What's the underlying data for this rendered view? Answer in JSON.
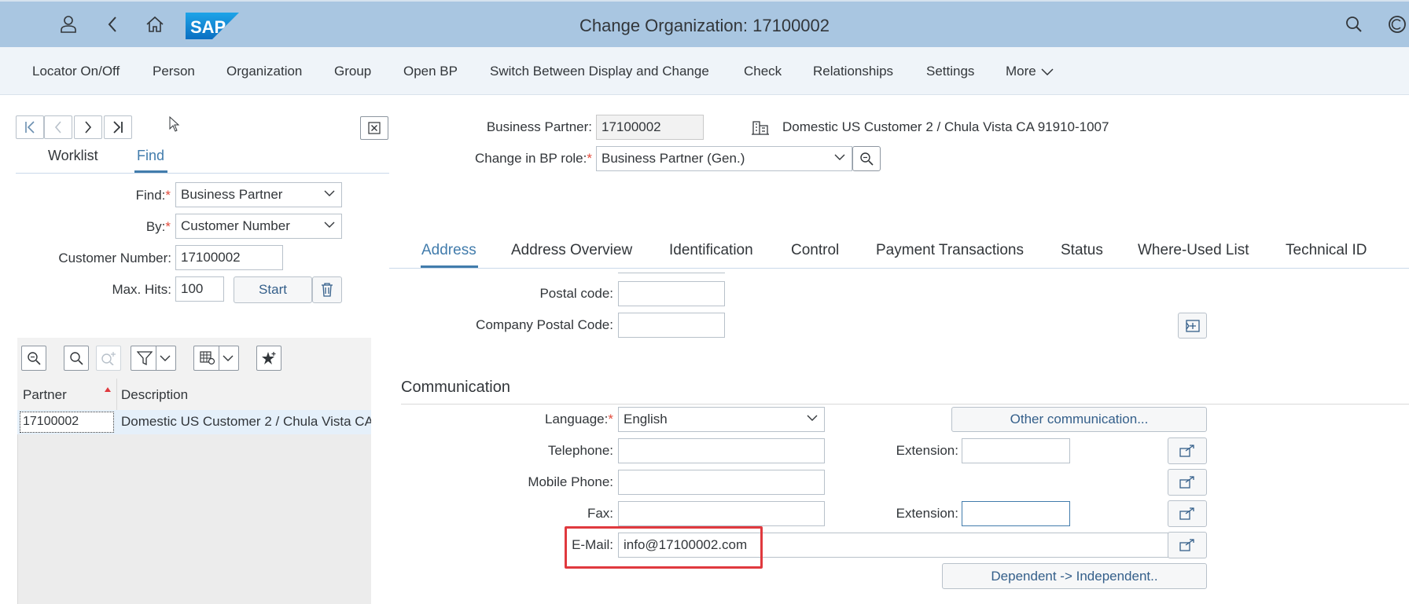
{
  "shell": {
    "title": "Change Organization: 17100002",
    "logo_text": "SAP"
  },
  "toolbar": {
    "items": [
      "Locator On/Off",
      "Person",
      "Organization",
      "Group",
      "Open BP",
      "Switch Between Display and Change",
      "Check",
      "Relationships",
      "Settings",
      "More"
    ]
  },
  "left_panel": {
    "tabs": [
      "Worklist",
      "Find"
    ],
    "active_tab": "Find",
    "find_label": "Find:",
    "find_value": "Business Partner",
    "by_label": "By:",
    "by_value": "Customer Number",
    "customer_number_label": "Customer Number:",
    "customer_number_value": "17100002",
    "max_hits_label": "Max. Hits:",
    "max_hits_value": "100",
    "start_label": "Start",
    "grid": {
      "columns": [
        "Partner",
        "Description"
      ],
      "rows": [
        {
          "partner": "17100002",
          "description": "Domestic US Customer 2 / Chula Vista CA"
        }
      ]
    }
  },
  "header": {
    "bp_label": "Business Partner:",
    "bp_value": "17100002",
    "bp_description": "Domestic US Customer 2 / Chula Vista CA 91910-1007",
    "role_label": "Change in BP role:",
    "role_value": "Business Partner (Gen.)"
  },
  "tabs": [
    "Address",
    "Address Overview",
    "Identification",
    "Control",
    "Payment Transactions",
    "Status",
    "Where-Used List",
    "Technical ID"
  ],
  "active_tab": "Address",
  "address": {
    "postal_code_label": "Postal code:",
    "postal_code_value": "",
    "company_postal_code_label": "Company Postal Code:",
    "company_postal_code_value": ""
  },
  "communication": {
    "title": "Communication",
    "language_label": "Language:",
    "language_value": "English",
    "other_comm_label": "Other communication...",
    "telephone_label": "Telephone:",
    "telephone_value": "",
    "extension_label": "Extension:",
    "tel_extension_value": "",
    "mobile_label": "Mobile Phone:",
    "mobile_value": "",
    "fax_label": "Fax:",
    "fax_value": "",
    "fax_extension_value": "",
    "email_label": "E-Mail:",
    "email_value": "info@17100002.com",
    "dependent_label": "Dependent -> Independent.."
  },
  "colors": {
    "shell_bg": "#a9c6e1",
    "toolbar_bg": "#eff4f9",
    "accent": "#427cac",
    "required": "#e34b3b",
    "highlight": "#e0393e"
  }
}
